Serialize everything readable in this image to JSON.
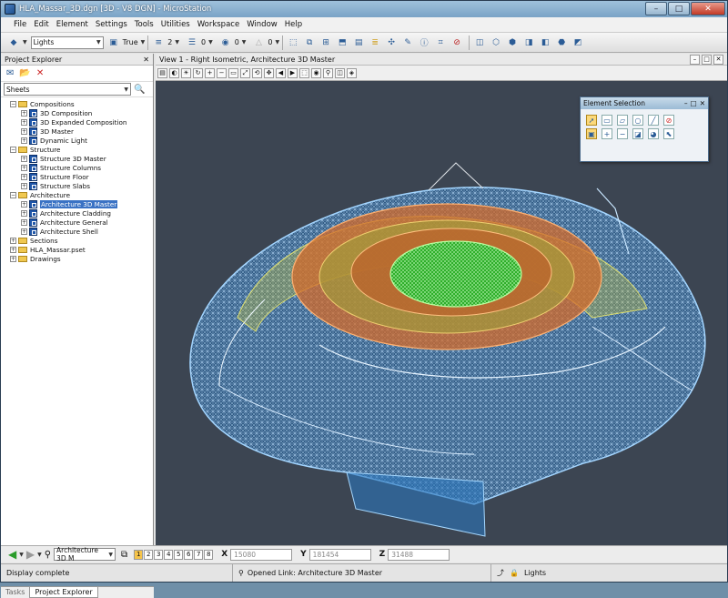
{
  "window": {
    "title": "HLA_Massar_3D.dgn [3D - V8 DGN] - MicroStation"
  },
  "menu": [
    "File",
    "Edit",
    "Element",
    "Settings",
    "Tools",
    "Utilities",
    "Workspace",
    "Window",
    "Help"
  ],
  "toolbar": {
    "level": "Lights",
    "attr": "True",
    "weight": "2",
    "style": "0",
    "color": "0",
    "transparency": "0"
  },
  "project_explorer": {
    "title": "Project Explorer",
    "selector": "Sheets",
    "tree": [
      {
        "label": "Compositions",
        "depth": 0,
        "type": "folder",
        "exp": "−"
      },
      {
        "label": "3D Composition",
        "depth": 1,
        "type": "model",
        "exp": "+"
      },
      {
        "label": "3D Expanded Composition",
        "depth": 1,
        "type": "model",
        "exp": "+"
      },
      {
        "label": "3D Master",
        "depth": 1,
        "type": "model",
        "exp": "+"
      },
      {
        "label": "Dynamic Light",
        "depth": 1,
        "type": "model",
        "exp": "+"
      },
      {
        "label": "Structure",
        "depth": 0,
        "type": "folder",
        "exp": "−"
      },
      {
        "label": "Structure 3D Master",
        "depth": 1,
        "type": "model",
        "exp": "+"
      },
      {
        "label": "Structure Columns",
        "depth": 1,
        "type": "model",
        "exp": "+"
      },
      {
        "label": "Structure Floor",
        "depth": 1,
        "type": "model",
        "exp": "+"
      },
      {
        "label": "Structure Slabs",
        "depth": 1,
        "type": "model",
        "exp": "+"
      },
      {
        "label": "Architecture",
        "depth": 0,
        "type": "folder",
        "exp": "−"
      },
      {
        "label": "Architecture 3D Master",
        "depth": 1,
        "type": "model",
        "exp": "+",
        "selected": true
      },
      {
        "label": "Architecture Cladding",
        "depth": 1,
        "type": "model",
        "exp": "+"
      },
      {
        "label": "Architecture General",
        "depth": 1,
        "type": "model",
        "exp": "+"
      },
      {
        "label": "Architecture Shell",
        "depth": 1,
        "type": "model",
        "exp": "+"
      },
      {
        "label": "Sections",
        "depth": 0,
        "type": "section",
        "exp": "+"
      },
      {
        "label": "HLA_Massar.pset",
        "depth": 0,
        "type": "pset",
        "exp": "+"
      },
      {
        "label": "Drawings",
        "depth": 0,
        "type": "drawing",
        "exp": "+"
      }
    ],
    "tabs": [
      "Tasks",
      "Project Explorer"
    ]
  },
  "view": {
    "title": "View 1 - Right Isometric, Architecture 3D Master"
  },
  "element_selection": {
    "title": "Element Selection"
  },
  "bottombar": {
    "model": "Architecture 3D M",
    "views": [
      "1",
      "2",
      "3",
      "4",
      "5",
      "6",
      "7",
      "8"
    ],
    "x_label": "X",
    "x": "15080",
    "y_label": "Y",
    "y": "181454",
    "z_label": "Z",
    "z": "31488"
  },
  "status": {
    "left": "Display complete",
    "middle": "Opened Link: Architecture 3D Master",
    "right": "Lights"
  }
}
